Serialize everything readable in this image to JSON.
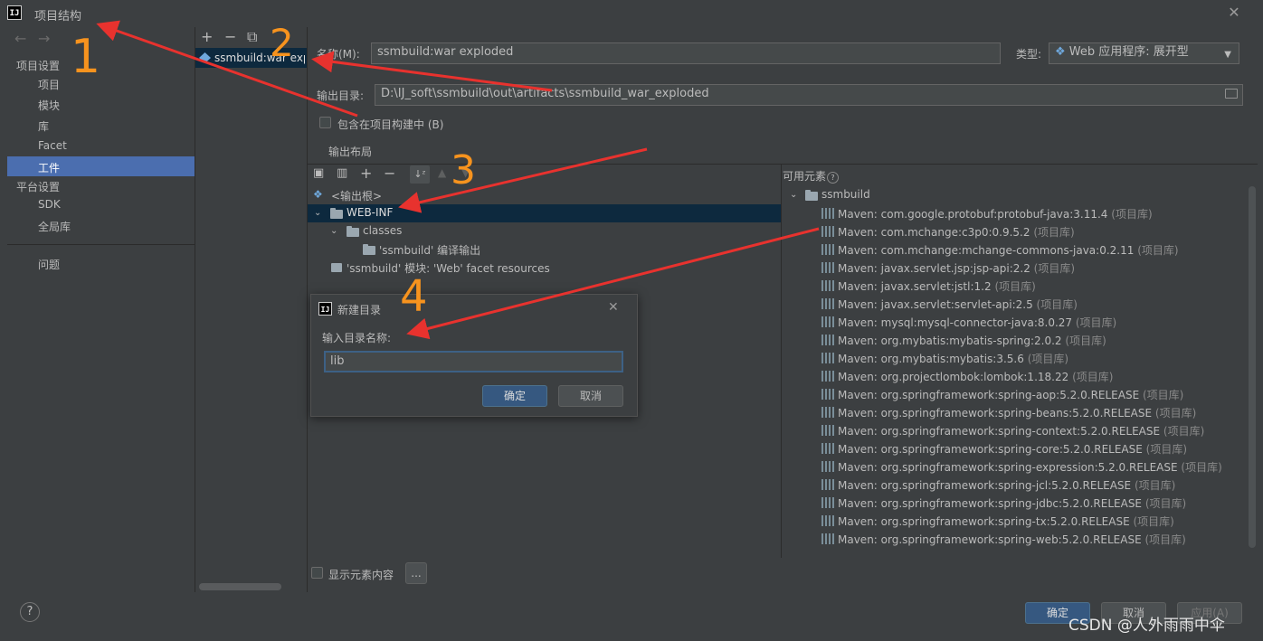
{
  "window": {
    "title": "项目结构",
    "logo_text": "IJ",
    "close_icon": "close-icon"
  },
  "left_nav": {
    "back_icon": "arrow-left-icon",
    "forward_icon": "arrow-right-icon",
    "project_settings_header": "项目设置",
    "project_items": [
      "项目",
      "模块",
      "库",
      "Facet",
      "工件"
    ],
    "platform_settings_header": "平台设置",
    "platform_items": [
      "SDK",
      "全局库"
    ],
    "problems": "问题",
    "selected": "工件"
  },
  "artifacts": {
    "toolbar": [
      "+",
      "−",
      "⧉"
    ],
    "items": [
      "ssmbuild:war exp"
    ]
  },
  "form": {
    "name_label": "名称(M):",
    "name_value": "ssmbuild:war exploded",
    "type_label": "类型:",
    "type_value": "Web 应用程序: 展开型",
    "output_dir_label": "输出目录:",
    "output_dir_value": "D:\\IJ_soft\\ssmbuild\\out\\artifacts\\ssmbuild_war_exploded",
    "include_in_build_label": "包含在项目构建中 (B)",
    "output_layout_tab": "输出布局",
    "show_content_label": "显示元素内容",
    "more_button": "..."
  },
  "tree": {
    "root": "<输出根>",
    "webinf": "WEB-INF",
    "classes": "classes",
    "compile_output": "'ssmbuild' 编译输出",
    "facet_resources": "'ssmbuild' 模块: 'Web' facet resources"
  },
  "available": {
    "header": "可用元素",
    "module": "ssmbuild",
    "tag": "(项目库)",
    "libraries": [
      "Maven: com.google.protobuf:protobuf-java:3.11.4",
      "Maven: com.mchange:c3p0:0.9.5.2",
      "Maven: com.mchange:mchange-commons-java:0.2.11",
      "Maven: javax.servlet.jsp:jsp-api:2.2",
      "Maven: javax.servlet:jstl:1.2",
      "Maven: javax.servlet:servlet-api:2.5",
      "Maven: mysql:mysql-connector-java:8.0.27",
      "Maven: org.mybatis:mybatis-spring:2.0.2",
      "Maven: org.mybatis:mybatis:3.5.6",
      "Maven: org.projectlombok:lombok:1.18.22",
      "Maven: org.springframework:spring-aop:5.2.0.RELEASE",
      "Maven: org.springframework:spring-beans:5.2.0.RELEASE",
      "Maven: org.springframework:spring-context:5.2.0.RELEASE",
      "Maven: org.springframework:spring-core:5.2.0.RELEASE",
      "Maven: org.springframework:spring-expression:5.2.0.RELEASE",
      "Maven: org.springframework:spring-jcl:5.2.0.RELEASE",
      "Maven: org.springframework:spring-jdbc:5.2.0.RELEASE",
      "Maven: org.springframework:spring-tx:5.2.0.RELEASE",
      "Maven: org.springframework:spring-web:5.2.0.RELEASE"
    ]
  },
  "dialog": {
    "title": "新建目录",
    "prompt": "输入目录名称:",
    "value": "lib",
    "ok": "确定",
    "cancel": "取消"
  },
  "footer": {
    "help": "?",
    "ok": "确定",
    "cancel": "取消",
    "apply": "应用(A)",
    "watermark": "CSDN @人外雨雨中伞"
  },
  "annotations": [
    "1",
    "2",
    "3",
    "4"
  ],
  "colors": {
    "background": "#3c3f41",
    "selection": "#4b6eaf",
    "tree_selection": "#0d293e",
    "arrow": "#e8322e",
    "handwriting": "#f7931e"
  }
}
